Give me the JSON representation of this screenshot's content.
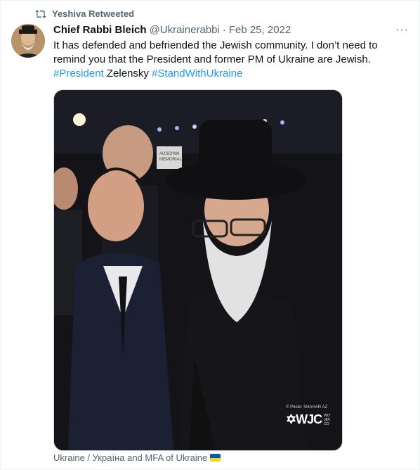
{
  "retweet": {
    "icon": "retweet-icon",
    "label": "Yeshiva Retweeted"
  },
  "tweet": {
    "author_name": "Chief Rabbi Bleich",
    "author_handle": "@Ukrainerabbi",
    "separator": "·",
    "date": "Feb 25, 2022",
    "more_label": "···",
    "text_part1": "It has defended and befriended the Jewish community. I don’t need to remind you that the President and former PM of Ukraine are Jewish.",
    "hashtag1": "#President",
    "text_part2": " Zelensky ",
    "hashtag2": "#StandWithUkraine"
  },
  "media": {
    "photo_credit": "© Photo: SHAHAR AZ",
    "logo_text": "✡WJC",
    "logo_side": [
      "WO",
      "JEV",
      "CO"
    ],
    "screen_text": [
      "AUSCHWI",
      "MEMORIAL"
    ]
  },
  "tagged": {
    "text": "Ukraine / Україна and MFA of Ukraine",
    "flag_colors": [
      "#0057b7",
      "#ffd700"
    ]
  },
  "colors": {
    "link": "#1d9bf0",
    "secondary_text": "#536471",
    "primary_text": "#0f1419"
  }
}
